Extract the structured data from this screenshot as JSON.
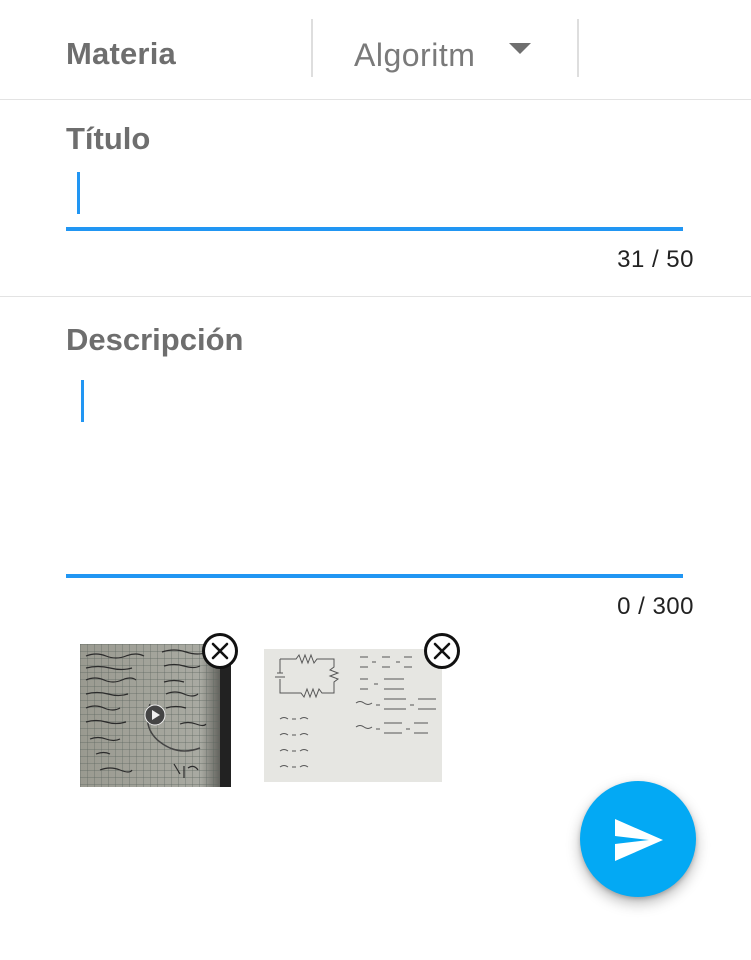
{
  "subject": {
    "label": "Materia",
    "selected": "Algoritm"
  },
  "title_field": {
    "label": "Título",
    "value": "",
    "counter": "31 / 50"
  },
  "description_field": {
    "label": "Descripción",
    "value": "",
    "counter": "0 / 300"
  },
  "attachments": [
    {
      "kind": "video",
      "icon": "play-icon",
      "remove_icon": "close-circle-icon"
    },
    {
      "kind": "image",
      "remove_icon": "close-circle-icon"
    }
  ],
  "fab": {
    "icon": "send-icon"
  },
  "colors": {
    "accent": "#2196f3",
    "fab": "#03a9f4",
    "label": "#6e6e6e"
  }
}
